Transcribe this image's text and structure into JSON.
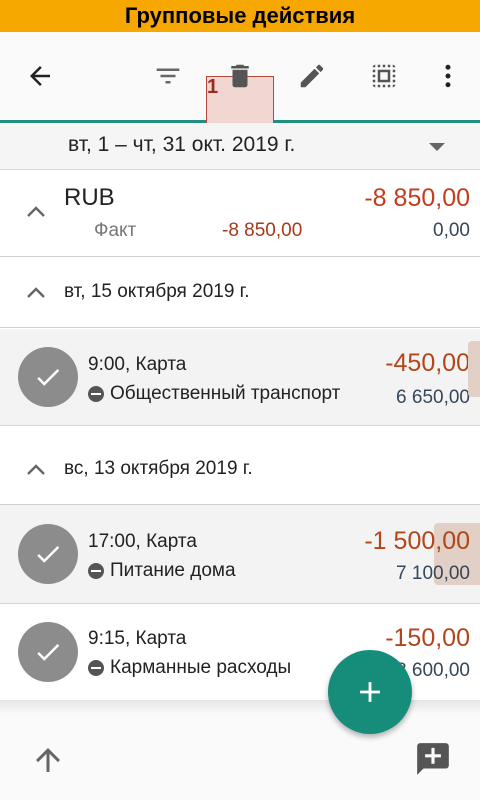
{
  "banner": {
    "title": "Групповые действия"
  },
  "toolbar": {
    "back_icon": "arrow-back-icon",
    "filter_icon": "filter-icon",
    "delete_icon": "trash-icon",
    "delete_step_number": "1",
    "edit_icon": "pencil-icon",
    "select_all_icon": "select-all-icon",
    "more_icon": "more-vert-icon",
    "accent_color": "#1f8f80",
    "highlight_color": "#f1d6d2"
  },
  "date_range": {
    "label": "вт, 1 – чт, 31 окт. 2019 г."
  },
  "summary": {
    "currency": "RUB",
    "total": "-8 850,00",
    "fact_label": "Факт",
    "fact_value": "-8 850,00",
    "fact_remaining": "0,00"
  },
  "days": [
    {
      "label": "вт, 15 октября 2019 г.",
      "transactions": [
        {
          "time_account": "9:00, Карта",
          "category": "Общественный транспорт",
          "amount": "-450,00",
          "balance": "6 650,00"
        }
      ]
    },
    {
      "label": "вс, 13 октября 2019 г.",
      "transactions": [
        {
          "time_account": "17:00, Карта",
          "category": "Питание дома",
          "amount": "-1 500,00",
          "balance": "7 100,00"
        },
        {
          "time_account": "9:15, Карта",
          "category": "Карманные расходы",
          "amount": "-150,00",
          "balance": "8 600,00"
        }
      ]
    }
  ],
  "fab": {
    "icon": "plus-icon",
    "color": "#168c7b"
  },
  "bottom_bar": {
    "up_icon": "arrow-up-icon",
    "comment_add_icon": "comment-add-icon"
  }
}
